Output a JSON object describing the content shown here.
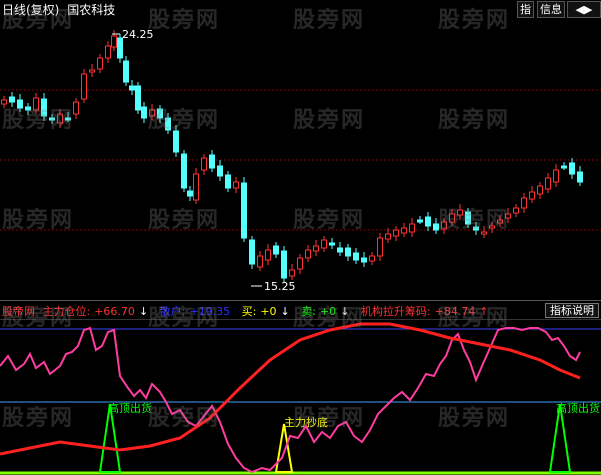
{
  "title_bar": {
    "period_label": "日线(复权)",
    "stock_name": "国农科技",
    "buttons": [
      "指",
      "信息"
    ],
    "arrows": "◀▶"
  },
  "price_chart": {
    "high_label": "24.25",
    "low_label": "15.25",
    "up_color": "#ff3232",
    "down_color": "#54ffff",
    "grid_color": "#8b0000"
  },
  "indicator": {
    "name": "股帝网",
    "fields": [
      {
        "label": "主力仓位:",
        "value": "+66.70",
        "arrow": "↓",
        "color": "#ff3232"
      },
      {
        "label": "散户:",
        "value": "+19.35",
        "arrow": "",
        "color": "#3030ff"
      },
      {
        "label": "买:",
        "value": "+0",
        "arrow": "↓",
        "color": "#ffff00"
      },
      {
        "label": "卖:",
        "value": "+0",
        "arrow": "↓",
        "color": "#00ff00"
      },
      {
        "label": "机构拉升筹码:",
        "value": "+84.74",
        "arrow": "↑",
        "color": "#ff3232"
      }
    ],
    "explain_button": "指标说明",
    "signal_labels": {
      "top_left": "高顶出货",
      "bottom_mid": "主力抄底",
      "top_right": "高顶出货"
    }
  },
  "watermark": "股旁网",
  "chart_data": {
    "type": "candlestick",
    "title": "国农科技",
    "series": [
      {
        "name": "主力仓位",
        "color": "#ff2020"
      },
      {
        "name": "散户",
        "color": "#ff3ca0"
      },
      {
        "name": "机构拉升筹码",
        "color": "#ff2020"
      }
    ],
    "annotations": [
      "24.25",
      "15.25"
    ],
    "approx_range": [
      15.25,
      24.25
    ]
  }
}
